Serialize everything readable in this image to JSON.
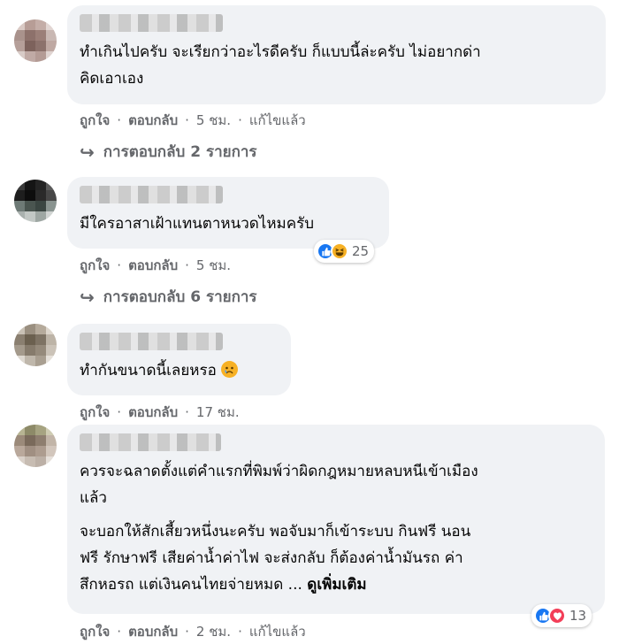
{
  "comments": [
    {
      "lines": [
        "ทำเกินไปครับ จะเรียกว่าอะไรดีครับ ก็แบบนี้ล่ะครับ ไม่อยากด่า",
        "คิดเอาเอง"
      ],
      "like": "ถูกใจ",
      "reply": "ตอบกลับ",
      "time": "5 ชม.",
      "edited": "แก้ไขแล้ว",
      "view_replies": "การตอบกลับ 2 รายการ"
    },
    {
      "lines": [
        "มีใครอาสาเฝ้าแทนตาหนวดไหมครับ"
      ],
      "like": "ถูกใจ",
      "reply": "ตอบกลับ",
      "time": "5 ชม.",
      "reaction_count": "25",
      "reaction_icons": [
        "like-icon",
        "haha-icon"
      ],
      "view_replies": "การตอบกลับ 6 รายการ"
    },
    {
      "lines": [
        "ทำกันขนาดนี้เลยหรอ"
      ],
      "emoji": "sad-face-emoji",
      "like": "ถูกใจ",
      "reply": "ตอบกลับ",
      "time": "17 ชม."
    },
    {
      "paragraph1": [
        "ควรจะฉลาดตั้งแต่คำแรกที่พิมพ์ว่าผิดกฎหมายหลบหนีเข้าเมือง",
        "แล้ว"
      ],
      "paragraph2": [
        "จะบอกให้สักเสี้ยวหนึ่งนะครับ พอจับมาก็เข้าระบบ กินฟรี นอน",
        "ฟรี รักษาฟรี เสียค่าน้ำค่าไฟ จะส่งกลับ ก็ต้องค่าน้ำมันรถ ค่า",
        "สึกหอรถ แต่เงินคนไทยจ่ายหมด ..."
      ],
      "see_more": "ดูเพิ่มเติม",
      "like": "ถูกใจ",
      "reply": "ตอบกลับ",
      "time": "2 ชม.",
      "edited": "แก้ไขแล้ว",
      "reaction_count": "13",
      "reaction_icons": [
        "like-icon",
        "love-icon"
      ]
    }
  ],
  "separator": "·",
  "colors": {
    "bubble": "#f0f2f5",
    "meta_text": "#65676b",
    "like_blue": "#1877f2",
    "haha_yellow": "#f7b125",
    "love_red": "#f33e58"
  }
}
